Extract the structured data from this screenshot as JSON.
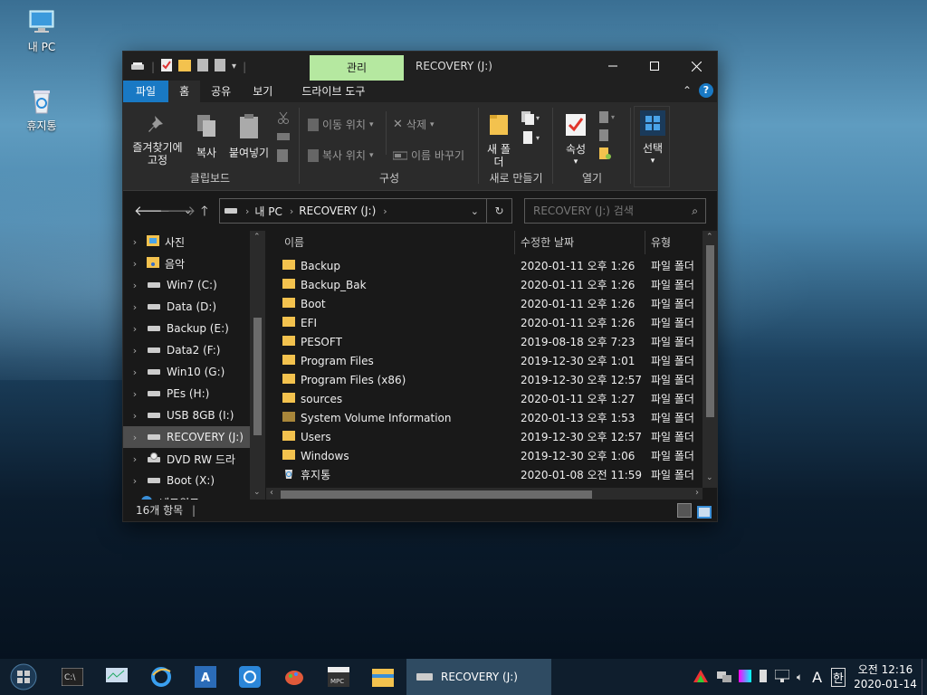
{
  "desktop": {
    "icons": [
      {
        "label": "내 PC"
      },
      {
        "label": "휴지통"
      }
    ]
  },
  "window": {
    "title": "RECOVERY (J:)",
    "context_tab": "관리",
    "tabs": [
      "파일",
      "홈",
      "공유",
      "보기",
      "드라이브 도구"
    ],
    "ribbon": {
      "clipboard": {
        "label": "클립보드",
        "pin": "즐겨찾기에 고정",
        "copy": "복사",
        "paste": "붙여넣기"
      },
      "organize": {
        "label": "구성",
        "move": "이동 위치",
        "copy_to": "복사 위치",
        "delete": "삭제",
        "rename": "이름 바꾸기"
      },
      "new": {
        "label": "새로 만들기",
        "new_folder": "새 폴더"
      },
      "open": {
        "label": "열기",
        "properties": "속성"
      },
      "select": {
        "label": "선택"
      }
    },
    "address": {
      "crumbs": [
        "내 PC",
        "RECOVERY (J:)"
      ],
      "search_placeholder": "RECOVERY (J:) 검색"
    },
    "nav_items": [
      {
        "label": "사진"
      },
      {
        "label": "음악"
      },
      {
        "label": "Win7 (C:)"
      },
      {
        "label": "Data (D:)"
      },
      {
        "label": "Backup (E:)"
      },
      {
        "label": "Data2 (F:)"
      },
      {
        "label": "Win10 (G:)"
      },
      {
        "label": "PEs (H:)"
      },
      {
        "label": "USB 8GB (I:)"
      },
      {
        "label": "RECOVERY (J:)"
      },
      {
        "label": "DVD RW 드라"
      },
      {
        "label": "Boot (X:)"
      },
      {
        "label": "네트워크"
      }
    ],
    "columns": {
      "name": "이름",
      "date": "수정한 날짜",
      "type": "유형"
    },
    "files": [
      {
        "name": "Backup",
        "date": "2020-01-11 오후 1:26",
        "type": "파일 폴더"
      },
      {
        "name": "Backup_Bak",
        "date": "2020-01-11 오후 1:26",
        "type": "파일 폴더"
      },
      {
        "name": "Boot",
        "date": "2020-01-11 오후 1:26",
        "type": "파일 폴더"
      },
      {
        "name": "EFI",
        "date": "2020-01-11 오후 1:26",
        "type": "파일 폴더"
      },
      {
        "name": "PESOFT",
        "date": "2019-08-18 오후 7:23",
        "type": "파일 폴더"
      },
      {
        "name": "Program Files",
        "date": "2019-12-30 오후 1:01",
        "type": "파일 폴더"
      },
      {
        "name": "Program Files (x86)",
        "date": "2019-12-30 오후 12:57",
        "type": "파일 폴더"
      },
      {
        "name": "sources",
        "date": "2020-01-11 오후 1:27",
        "type": "파일 폴더"
      },
      {
        "name": "System Volume Information",
        "date": "2020-01-13 오후 1:53",
        "type": "파일 폴더"
      },
      {
        "name": "Users",
        "date": "2019-12-30 오후 12:57",
        "type": "파일 폴더"
      },
      {
        "name": "Windows",
        "date": "2019-12-30 오후 1:06",
        "type": "파일 폴더"
      },
      {
        "name": "휴지통",
        "date": "2020-01-08 오전 11:59",
        "type": "파일 폴더"
      }
    ],
    "status": "16개 항목"
  },
  "taskbar": {
    "active_window": "RECOVERY (J:)",
    "ime": "A",
    "lang": "한",
    "time": "오전 12:16",
    "date": "2020-01-14"
  },
  "colors": {
    "file_tab": "#1979c4",
    "context_tab": "#b5e8a0",
    "folder": "#f3c24e",
    "window_bg": "#191919",
    "taskbar": "#0f1e2d"
  }
}
